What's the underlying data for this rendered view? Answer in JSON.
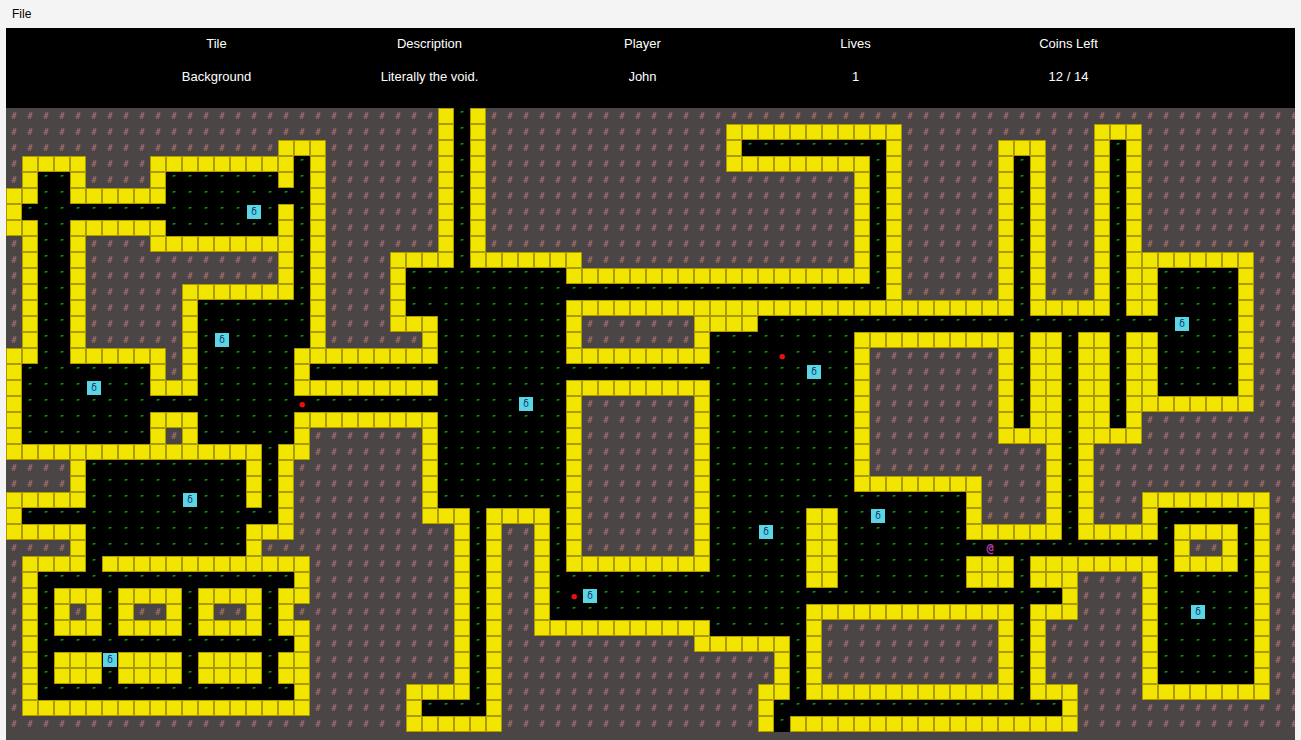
{
  "menu": [
    "File"
  ],
  "info": [
    {
      "label": "Tile",
      "value": "Background"
    },
    {
      "label": "Description",
      "value": "Literally the void."
    },
    {
      "label": "Player",
      "value": "John"
    },
    {
      "label": "Lives",
      "value": "1"
    },
    {
      "label": "Coins Left",
      "value": "12 / 14"
    }
  ],
  "map": {
    "glyphs": {
      "void": "#",
      "wall": " ",
      "floor": "″",
      "coin": "δ",
      "enemy": "●",
      "player": "@"
    },
    "rows": [
      "########################### ″ ###################################################",
      "########################### ″ ###############           ############   ##########",
      "#################   ####### ″ ############### ″″″″″″″″″ ######   ### ″ ##########",
      "#    ####         ″ ####### ″ ###############         ″ ###### ″ ### ″ ##########",
      "# ″″ #### ″″″″″″″ ″ ####### ″ ####################### ″ ###### ″ ### ″ ##########",
      "  ″″      ″″″″″″″″″ ####### ″ ####################### ″ ###### ″ ### ″ ##########",
      " ″″″″″″″″″″″″″″δ″ ″ ####### ″ ####################### ″ ###### ″ ### ″ ##########",
      "  ″″      ″″″″″″″ ″ ####### ″ ####################### ″ ###### ″ ### ″ ##########",
      "# ″″ ####         ″ ####### ″ ####################### ″ ###### ″ ### ″ ##########",
      "# ″″ ############ ″ ####    ″       ################# ″ ###### ″ ### ″        ###",
      "# ″″ ############ ″ #### ″″″″″″″″″″                   ″ ###### ″ ### ″  ″″″″″ ###",
      "# ″″ ######       ″ #### ″″″″″″″″″″″″″″″″″″″″″″″″″″″″″″ ###### ″ ### ″  ″″″″″ ###",
      "# ″″ ###### ″″″″″″″ #### ″″″″″″″″″″                            ″     ″  ″″″″″ ###",
      "# ″″ ###### ″″″″″″″ ####   ″″″″″″″″ #######    ″″″″″″″″″″″″″″″″″″″″″″″″″″δ″″″ ###",
      "# ″″ ###### ″δ″″″″″ ###### ″″″″″″″″ ####### ″″″″″″″″″          ″  ″  ″  ″″″″″ ###",
      "  ″″      # ″″″″″″         ″″″″″″″″         ″″″″●″″″″ ######## ″  ″  ″  ″″″″″ ###",
      " ″″″″″″″″ # ″″″″″″ ″″″″″″″″″″″″″″″″″″″″″″″″″″″″″″″δ″″ ######## ″  ″  ″  ″″″″″ ###",
      " ″″″″δ″″″   ″″″″″″         ″″″″″″″″         ″″″″″″″″″ ######## ″  ″  ″  ″″″″″ ###",
      " ″″″″″″″″″″″″″″″″″●″″″″″″″″″″″″″δ″″ ####### ″″″″″″″″″ ######## ″  ″  ″        ###",
      " ″″″″″″″″   ″″″″″″         ″″″″″″″″ ####### ″″″″″″″″″ ######## ″  ″  ″ ##########",
      " ″″″″″″″″ # ″″″″″″ ####### ″″″″″″″″ ####### ″″″″″″″″″ ########    ″    ##########",
      "                ″  ####### ″″″″″″″″ ####### ″″″″″″″″″ ########### ″ #############",
      "#### ″″″″″″″″″″ ″ ######## ″″″″″″″″ ####### ″″″″″″″″″ ########### ″ #############",
      "#### ″″″″″″″″″″ ″ ######## ″″″″″″″″ ####### ″″″″″″″″″        #### ″ #############",
      "     ″″″″″″δ″″″ ″ ######## ″″″″″″″″ ####### ″″″″″″″″″″″″″″″″ #### ″ ###        ##",
      " ″″″″″″″″″″″″″″″″ ########   ″    ″ ####### ″″″″″″  ″″δ″″″″″ #### ″ ### ″″″″″″ ##",
      "     ″″″″″″″″″″   ########## ″ ## ″ ####### ″″″δ″″  ″″″″″″″″      ″     ″    ″ ##",
      "#### ″″″″″″″″″″ ############ ″ ## ″ ####### ″″″″″″  ″″″″″″″″″@″″″″″″″″″″″ ## ″ ##",
      "#    ″             ######### ″ ## ″         ″″″″″″  ″″″″″″″″   ″        ″    ″ ##",
      "# ″″″″″″″″″″″″″″″″ ######### ″ ## ″″″″″″″″″″″″″″″″  ″″″″″″″″   ″   #### ″″″″″″ ##",
      "# ″   ″    ″    ″  ######### ″ ## ″●δ″″″″″″″″″″″″″″″″″″″″″″″″″″″″″ #### ″″″″″″ ##",
      "# ″ # ″ ## ″ ## ″ ########## ″ ## ″″″″″″″″″″″″″″″″             ″   #### ″″δ″″″ ##",
      "# ″   ″    ″    ″  ######### ″ ##           ″″″″″″ ########### ″ ###### ″″″″″″ ##",
      "# ″″″″″″″″″″″″″″″″ ######### ″ ############      ″ ########### ″ ###### ″″″″″″ ##",
      "# ″   δ    ″    ″  ######### ″ ################# ″ ########### ″ ###### ″″″″″″ ##",
      "# ″   ″    ″    ″  ######### ″ ################# ″ ########### ″ ###### ″″″″″″ ##",
      "# ″″″″″″″″″″″″″″″″ ######    ″ ################  ″             ″   ####        ##",
      "#                  ###### ″″″″ ################ ″″″″″″″″″″″″″″″″″″ ##############",
      "#########################      ################ ″                  ##############"
    ]
  }
}
